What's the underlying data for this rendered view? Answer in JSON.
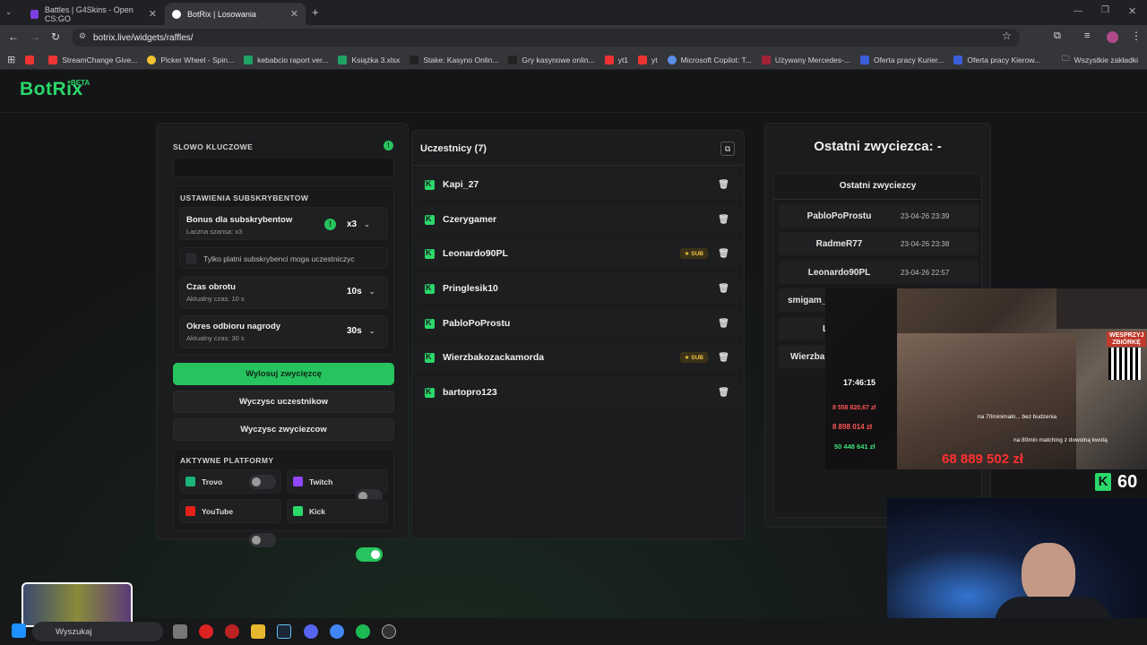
{
  "browser": {
    "tabs": [
      {
        "title": "Battles | G4Skins - Open CS:GO",
        "active": false
      },
      {
        "title": "BotRix | Losowania",
        "active": true
      }
    ],
    "url": "botrix.live/widgets/raffles/",
    "bookmarks": [
      "StreamChange Give...",
      "Picker Wheel - Spin...",
      "kebabcio raport ver...",
      "Książka 3.xlsx",
      "Stake: Kasyno Onlin...",
      "Gry kasynowe onlin...",
      "yt1",
      "yt",
      "Microsoft Copilot: T...",
      "Używany Mercedes-...",
      "Oferta pracy Kurier...",
      "Oferta pracy Kierow..."
    ],
    "all_bookmarks": "Wszystkie zakładki"
  },
  "header": {
    "logo": "BotRix",
    "badge": "BETA"
  },
  "left": {
    "keyword_label": "SLOWO KLUCZOWE",
    "keyword_value": "",
    "sub_settings_label": "USTAWIENIA SUBSKRYBENTOW",
    "bonus_title": "Bonus dla subskrybentow",
    "bonus_sub": "Laczna szansa: x3",
    "bonus_value": "x3",
    "only_paid": "Tylko platni subskrybenci moga uczestniczyc",
    "spin_title": "Czas obrotu",
    "spin_sub": "Aktualny czas: 10 s",
    "spin_value": "10s",
    "claim_title": "Okres odbioru nagrody",
    "claim_sub": "Aktualny czas: 30 s",
    "claim_value": "30s",
    "draw_button": "Wylosuj zwycięzcę",
    "clear_participants": "Wyczysc uczestnikow",
    "clear_winners": "Wyczysc zwyciezcow",
    "platforms_label": "AKTYWNE PLATFORMY",
    "platforms": [
      {
        "name": "Trovo",
        "on": false
      },
      {
        "name": "Twitch",
        "on": false
      },
      {
        "name": "YouTube",
        "on": false
      },
      {
        "name": "Kick",
        "on": true
      }
    ]
  },
  "middle": {
    "title": "Uczestnicy (7)",
    "participants": [
      {
        "name": "Kapi_27",
        "sub": false
      },
      {
        "name": "Czerygamer",
        "sub": false
      },
      {
        "name": "Leonardo90PL",
        "sub": true
      },
      {
        "name": "Pringlesik10",
        "sub": false
      },
      {
        "name": "PabloPoProstu",
        "sub": false
      },
      {
        "name": "Wierzbakozackamorda",
        "sub": true
      },
      {
        "name": "bartopro123",
        "sub": false
      }
    ],
    "sub_badge": "SUB"
  },
  "right": {
    "title": "Ostatni zwyciezca: -",
    "list_title": "Ostatni zwyciezcy",
    "winners": [
      {
        "name": "PabloPoProstu",
        "time": "23-04-26 23:39"
      },
      {
        "name": "RadmeR77",
        "time": "23-04-26 23:38"
      },
      {
        "name": "Leonardo90PL",
        "time": "23-04-26 22:57"
      },
      {
        "name": "smigam_",
        "time": ""
      },
      {
        "name": "L",
        "time": ""
      },
      {
        "name": "Wierzba",
        "time": ""
      }
    ]
  },
  "stream_overlay": {
    "clock": "17:46:15",
    "amount1": "8 558 820,67 zł",
    "amount2": "8 898 014 zł",
    "amount3": "50 448 641 zł",
    "big_amount": "68 889 502 zł",
    "viewer_count": "60",
    "donate_label": "WESPRZYJ ZBIÓRKĘ",
    "ticker_line1": "na 70minimaln... bez budzenia",
    "ticker_line2": "na 80min matching z dowolną kwotą"
  },
  "taskbar": {
    "search": "Wyszukaj"
  }
}
